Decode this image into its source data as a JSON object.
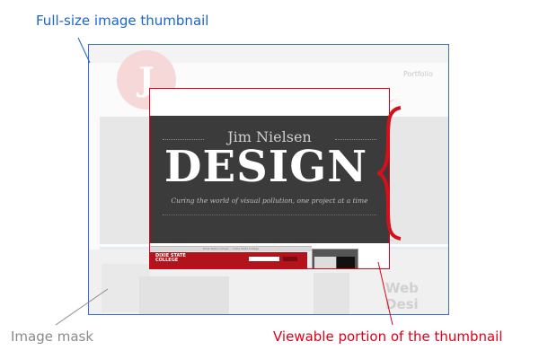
{
  "labels": {
    "full_size": "Full-size image thumbnail",
    "mask": "Image mask",
    "viewable": "Viewable portion of the thumbnail"
  },
  "thumbnail_page": {
    "nav_item": "Portfolio",
    "name": "Jim Nielsen",
    "headline": "DESIGN",
    "tagline": "Curing the world of visual pollution, one project at a time",
    "logo_letter": "J",
    "side_text": "Web Desi",
    "screenshot_brand": "DIXIE STATE\nCOLLEGE",
    "screenshot_title": "Dixie State College — Dixie State College"
  },
  "colors": {
    "full_size": "#1a64d6",
    "mask": "#8a8a8a",
    "viewable": "#e0001a"
  }
}
